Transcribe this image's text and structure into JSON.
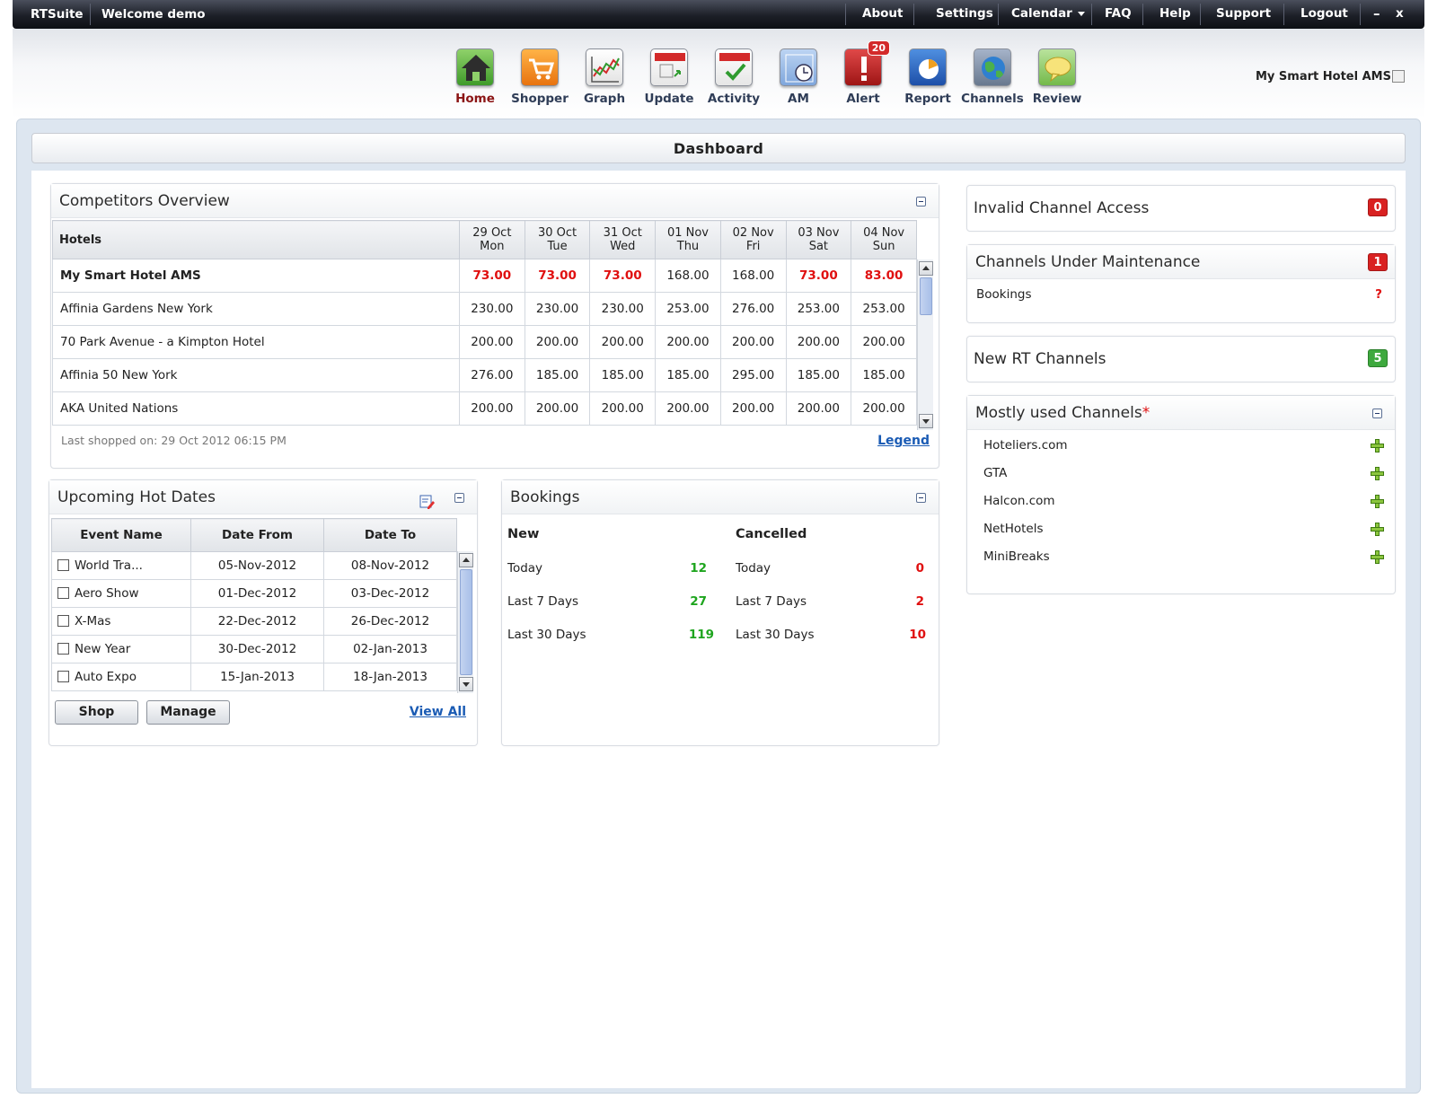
{
  "topbar": {
    "brand": "RTSuite",
    "welcome": "Welcome demo",
    "menu": {
      "about": "About",
      "settings": "Settings",
      "calendar": "Calendar",
      "faq": "FAQ",
      "help": "Help",
      "support": "Support",
      "logout": "Logout"
    },
    "minimize": "–",
    "close": "x"
  },
  "toolbar": {
    "home": "Home",
    "shopper": "Shopper",
    "graph": "Graph",
    "update": "Update",
    "activity": "Activity",
    "am": "AM",
    "alert": "Alert",
    "alert_count": "20",
    "report": "Report",
    "channels": "Channels",
    "review": "Review"
  },
  "hotel_name": "My Smart Hotel AMS",
  "dashboard_title": "Dashboard",
  "competitors": {
    "title": "Competitors Overview",
    "hotels_header": "Hotels",
    "dates": [
      {
        "date": "29 Oct",
        "day": "Mon"
      },
      {
        "date": "30 Oct",
        "day": "Tue"
      },
      {
        "date": "31 Oct",
        "day": "Wed"
      },
      {
        "date": "01 Nov",
        "day": "Thu"
      },
      {
        "date": "02 Nov",
        "day": "Fri"
      },
      {
        "date": "03 Nov",
        "day": "Sat"
      },
      {
        "date": "04 Nov",
        "day": "Sun"
      }
    ],
    "rows": [
      {
        "name": "My Smart Hotel AMS",
        "rates": [
          "73.00",
          "73.00",
          "73.00",
          "168.00",
          "168.00",
          "73.00",
          "83.00"
        ]
      },
      {
        "name": "Affinia Gardens New York",
        "rates": [
          "230.00",
          "230.00",
          "230.00",
          "253.00",
          "276.00",
          "253.00",
          "253.00"
        ]
      },
      {
        "name": "70 Park Avenue - a Kimpton Hotel",
        "rates": [
          "200.00",
          "200.00",
          "200.00",
          "200.00",
          "200.00",
          "200.00",
          "200.00"
        ]
      },
      {
        "name": "Affinia 50 New York",
        "rates": [
          "276.00",
          "185.00",
          "185.00",
          "185.00",
          "295.00",
          "185.00",
          "185.00"
        ]
      },
      {
        "name": "AKA United Nations",
        "rates": [
          "200.00",
          "200.00",
          "200.00",
          "200.00",
          "200.00",
          "200.00",
          "200.00"
        ]
      }
    ],
    "last_shopped": "Last shopped on: 29 Oct 2012 06:15 PM",
    "legend": "Legend"
  },
  "hot_dates": {
    "title": "Upcoming Hot Dates",
    "headers": {
      "event": "Event Name",
      "from": "Date From",
      "to": "Date To"
    },
    "rows": [
      {
        "event": "World Tra...",
        "from": "05-Nov-2012",
        "to": "08-Nov-2012"
      },
      {
        "event": "Aero Show",
        "from": "01-Dec-2012",
        "to": "03-Dec-2012"
      },
      {
        "event": "X-Mas",
        "from": "22-Dec-2012",
        "to": "26-Dec-2012"
      },
      {
        "event": "New Year",
        "from": "30-Dec-2012",
        "to": "02-Jan-2013"
      },
      {
        "event": "Auto Expo",
        "from": "15-Jan-2013",
        "to": "18-Jan-2013"
      }
    ],
    "shop": "Shop",
    "manage": "Manage",
    "view_all": "View All"
  },
  "bookings": {
    "title": "Bookings",
    "new_header": "New",
    "cancelled_header": "Cancelled",
    "new": [
      {
        "label": "Today",
        "value": "12"
      },
      {
        "label": "Last 7 Days",
        "value": "27"
      },
      {
        "label": "Last 30 Days",
        "value": "119"
      }
    ],
    "cancelled": [
      {
        "label": "Today",
        "value": "0"
      },
      {
        "label": "Last 7 Days",
        "value": "2"
      },
      {
        "label": "Last 30 Days",
        "value": "10"
      }
    ]
  },
  "invalid_access": {
    "title": "Invalid Channel Access",
    "count": "0"
  },
  "maintenance": {
    "title": "Channels Under Maintenance",
    "count": "1",
    "item": "Bookings",
    "item_status": "?"
  },
  "new_rt": {
    "title": "New RT Channels",
    "count": "5"
  },
  "mostly_used": {
    "title": "Mostly used Channels",
    "asterisk": "*",
    "items": [
      "Hoteliers.com",
      "GTA",
      "Halcon.com",
      "NetHotels",
      "MiniBreaks"
    ]
  },
  "colors": {
    "accent_red": "#e01010",
    "accent_green": "#1ea51e",
    "link_blue": "#1a5bb4",
    "active_tab": "#8b1414"
  }
}
